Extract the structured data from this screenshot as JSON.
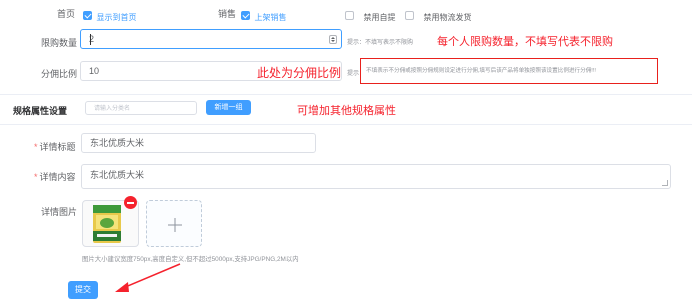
{
  "top_row": {
    "homepage_label": "首页",
    "homepage_option": "显示到首页",
    "sales_label": "销售",
    "sales_option": "上架销售",
    "self_pickup_option": "禁用自提",
    "logistics_option": "禁用物流发货"
  },
  "purchase_limit": {
    "label": "限购数量",
    "value": "2",
    "hint": "提示：不填写表示不限购",
    "annotation": "每个人限购数量，不填写代表不限购"
  },
  "commission": {
    "label": "分佣比例",
    "value": "10",
    "annotation": "此处为分佣比例",
    "hint_prefix": "提示：",
    "hint_boxed": "不填表示不分佣或按照分佣规则设定进行分佣,填写后该产品将单独按照该设置比例进行分佣!!!"
  },
  "spec_attr": {
    "label": "规格属性设置",
    "placeholder": "请输入分类名",
    "add_button": "新增一组",
    "annotation": "可增加其他规格属性"
  },
  "detail_title": {
    "label": "详情标题",
    "value": "东北优质大米"
  },
  "detail_content": {
    "label": "详情内容",
    "value": "东北优质大米"
  },
  "detail_images": {
    "label": "详情图片",
    "help": "图片大小建议宽度750px,高度自定义,但不超过5000px,支持JPG/PNG,2M以内"
  },
  "submit_label": "提交",
  "colors": {
    "primary": "#409eff",
    "annotation_red": "#f5222d",
    "hint_gray": "#909399"
  }
}
